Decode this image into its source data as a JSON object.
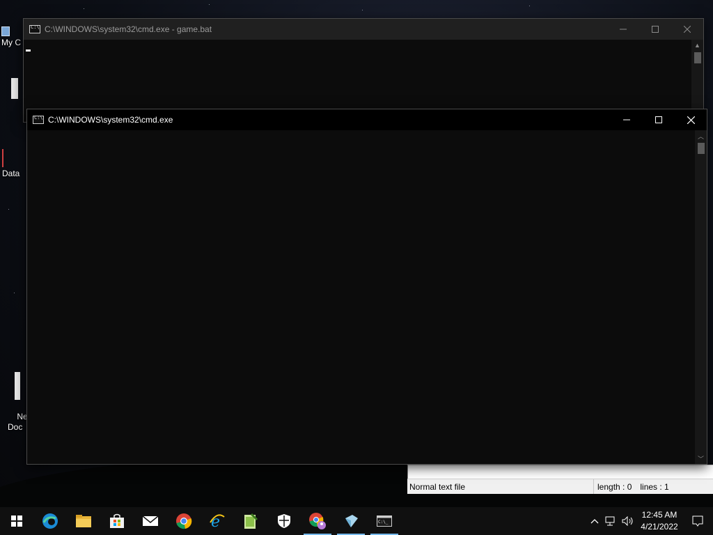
{
  "desktop": {
    "icons": [
      {
        "label": "My C"
      },
      {
        "label": "Data"
      },
      {
        "label": "Ne\nDoc"
      }
    ]
  },
  "windows": {
    "back": {
      "title": "C:\\WINDOWS\\system32\\cmd.exe - game.bat"
    },
    "front": {
      "title": "C:\\WINDOWS\\system32\\cmd.exe"
    }
  },
  "notepad": {
    "status_type": "Normal text file",
    "status_length": "length : 0",
    "status_lines": "lines : 1"
  },
  "taskbar": {
    "apps": [
      {
        "name": "start",
        "icon": "windows-logo-icon"
      },
      {
        "name": "edge",
        "icon": "edge-icon"
      },
      {
        "name": "file-explorer",
        "icon": "folder-icon"
      },
      {
        "name": "store",
        "icon": "store-icon"
      },
      {
        "name": "mail",
        "icon": "mail-icon"
      },
      {
        "name": "chrome",
        "icon": "chrome-icon"
      },
      {
        "name": "internet-explorer",
        "icon": "ie-icon"
      },
      {
        "name": "notepad-plus-plus",
        "icon": "notepadpp-icon"
      },
      {
        "name": "windows-security",
        "icon": "shield-icon"
      },
      {
        "name": "chrome-profile",
        "icon": "chrome-profile-icon"
      },
      {
        "name": "virtualbox",
        "icon": "cube-icon"
      },
      {
        "name": "command-prompt",
        "icon": "cmd-icon"
      }
    ],
    "clock_time": "12:45 AM",
    "clock_date": "4/21/2022"
  },
  "colors": {
    "console_bg": "#0c0c0c",
    "taskbar_bg": "#101010",
    "accent": "#76b9ed"
  }
}
